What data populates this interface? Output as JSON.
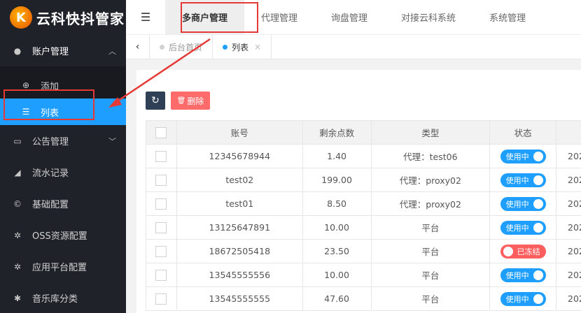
{
  "app": {
    "logo_text": "云科快抖管家",
    "logo_glyph": "K"
  },
  "sidebar": {
    "groups": [
      {
        "label": "账户管理",
        "icon": "user-icon",
        "chevron": "︿",
        "children": [
          {
            "label": "添加",
            "icon": "plus-circle-icon"
          },
          {
            "label": "列表",
            "icon": "list-icon"
          }
        ]
      },
      {
        "label": "公告管理",
        "icon": "card-icon",
        "chevron": "﹀"
      },
      {
        "label": "流水记录",
        "icon": "chart-icon"
      },
      {
        "label": "基础配置",
        "icon": "cc-icon"
      },
      {
        "label": "OSS资源配置",
        "icon": "gear-icon"
      },
      {
        "label": "应用平台配置",
        "icon": "gear-icon"
      },
      {
        "label": "音乐库分类",
        "icon": "asterisk-icon"
      }
    ]
  },
  "header": {
    "menu_icon": "☰",
    "tabs": [
      "多商户管理",
      "代理管理",
      "询盘管理",
      "对接云科系统",
      "系统管理"
    ]
  },
  "page_tabs": {
    "prev_icon": "‹",
    "items": [
      {
        "label": "后台首页"
      },
      {
        "label": "列表",
        "close": "×"
      }
    ]
  },
  "toolbar": {
    "refresh_icon": "↻",
    "delete_label": "删除",
    "delete_icon": "🗑"
  },
  "table": {
    "columns": [
      "账号",
      "剩余点数",
      "类型",
      "状态"
    ],
    "rows": [
      {
        "account": "12345678944",
        "points": "1.40",
        "type": "代理：test06",
        "status": "使用中",
        "extra": "202"
      },
      {
        "account": "test02",
        "points": "199.00",
        "type": "代理：proxy02",
        "status": "使用中",
        "extra": "202"
      },
      {
        "account": "test01",
        "points": "8.50",
        "type": "代理：proxy02",
        "status": "使用中",
        "extra": "202"
      },
      {
        "account": "13125647891",
        "points": "10.00",
        "type": "平台",
        "status": "使用中",
        "extra": "202"
      },
      {
        "account": "18672505418",
        "points": "23.50",
        "type": "平台",
        "status": "已冻结",
        "extra": "202"
      },
      {
        "account": "13545555556",
        "points": "10.00",
        "type": "平台",
        "status": "使用中",
        "extra": "202"
      },
      {
        "account": "13545555555",
        "points": "47.60",
        "type": "平台",
        "status": "使用中",
        "extra": "202"
      }
    ]
  },
  "colors": {
    "accent": "#1e9fff",
    "sidebar_bg": "#20222a",
    "danger": "#ff5e5e",
    "annotation": "#e53935"
  }
}
